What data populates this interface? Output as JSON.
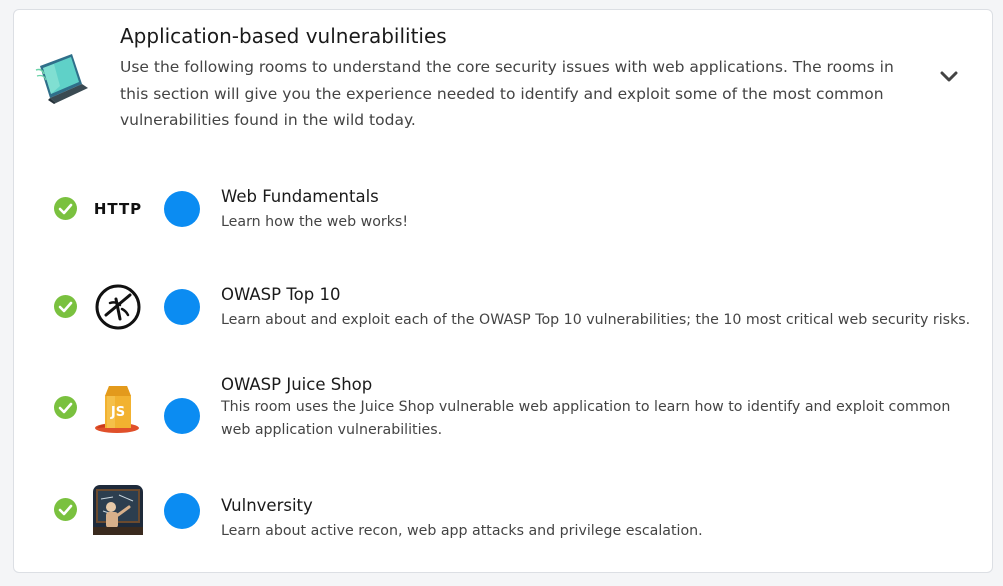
{
  "section": {
    "title": "Application-based vulnerabilities",
    "description": "Use the following rooms to understand the core security issues with web applications. The rooms in this section will give you the experience needed to identify and exploit some of the most common vulnerabilities found in the wild today.",
    "icon": "laptop-icon",
    "collapse_icon": "chevron-down-icon"
  },
  "colors": {
    "check_green": "#7ac13f",
    "dot_blue": "#0b8cf2"
  },
  "rooms": [
    {
      "title": "Web Fundamentals",
      "description": "Learn how the web works!",
      "icon": "http-logo-icon",
      "icon_text": "HTTP",
      "status": "completed"
    },
    {
      "title": "OWASP Top 10",
      "description": "Learn about and exploit each of the OWASP Top 10 vulnerabilities; the 10 most critical web security risks.",
      "icon": "owasp-logo-icon",
      "status": "completed"
    },
    {
      "title": "OWASP Juice Shop",
      "description": "This room uses the Juice Shop vulnerable web application to learn how to identify and exploit common web application vulnerabilities.",
      "icon": "juice-shop-logo-icon",
      "icon_text": "JS",
      "status": "completed"
    },
    {
      "title": "Vulnversity",
      "description": "Learn about active recon, web app attacks and privilege escalation.",
      "icon": "vulnversity-logo-icon",
      "status": "completed"
    }
  ]
}
